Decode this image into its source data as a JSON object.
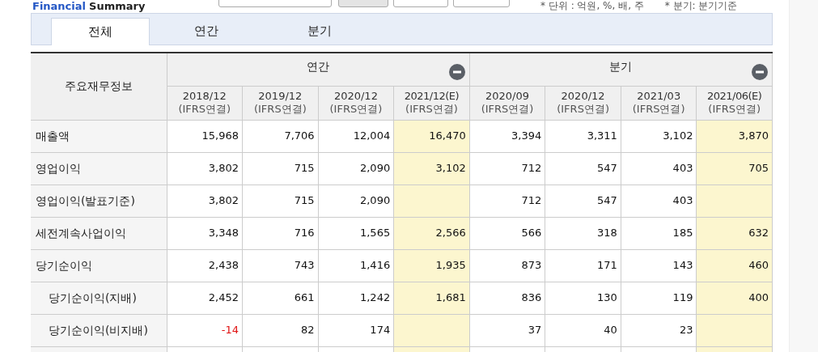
{
  "heading": {
    "part1": "Financial",
    "part2": "Summary"
  },
  "notes": [
    "* 단위 : 억원, %, 배, 주",
    "* 분기: 분기기준"
  ],
  "tabs": [
    {
      "label": "전체",
      "selected": true
    },
    {
      "label": "연간",
      "selected": false
    },
    {
      "label": "분기",
      "selected": false
    }
  ],
  "table": {
    "corner": "주요재무정보",
    "groups": [
      {
        "label": "연간"
      },
      {
        "label": "분기"
      }
    ],
    "columns": [
      {
        "period": "2018/12",
        "basis": "(IFRS연결)",
        "estimate": false
      },
      {
        "period": "2019/12",
        "basis": "(IFRS연결)",
        "estimate": false
      },
      {
        "period": "2020/12",
        "basis": "(IFRS연결)",
        "estimate": false
      },
      {
        "period": "2021/12(E)",
        "basis": "(IFRS연결)",
        "estimate": true
      },
      {
        "period": "2020/09",
        "basis": "(IFRS연결)",
        "estimate": false
      },
      {
        "period": "2020/12",
        "basis": "(IFRS연결)",
        "estimate": false
      },
      {
        "period": "2021/03",
        "basis": "(IFRS연결)",
        "estimate": false
      },
      {
        "period": "2021/06(E)",
        "basis": "(IFRS연결)",
        "estimate": true
      }
    ],
    "rows": [
      {
        "label": "매출액",
        "values": [
          "15,968",
          "7,706",
          "12,004",
          "16,470",
          "3,394",
          "3,311",
          "3,102",
          "3,870"
        ]
      },
      {
        "label": "영업이익",
        "values": [
          "3,802",
          "715",
          "2,090",
          "3,102",
          "712",
          "547",
          "403",
          "705"
        ]
      },
      {
        "label": "영업이익(발표기준)",
        "values": [
          "3,802",
          "715",
          "2,090",
          {
            "kind": "empty"
          },
          "712",
          "547",
          "403",
          {
            "kind": "empty"
          }
        ]
      },
      {
        "label": "세전계속사업이익",
        "values": [
          "3,348",
          "716",
          "1,565",
          "2,566",
          "566",
          "318",
          "185",
          "632"
        ]
      },
      {
        "label": "당기순이익",
        "values": [
          "2,438",
          "743",
          "1,416",
          "1,935",
          "873",
          "171",
          "143",
          "460"
        ],
        "children": [
          {
            "label": "당기순이익(지배)",
            "values": [
              "2,452",
              "661",
              "1,242",
              "1,681",
              "836",
              "130",
              "119",
              "400"
            ]
          },
          {
            "label": "당기순이익(비지배)",
            "values": [
              {
                "text": "-14",
                "negative": true
              },
              "82",
              "174",
              {
                "kind": "empty"
              },
              "37",
              "40",
              "23",
              {
                "kind": "empty"
              }
            ]
          }
        ]
      }
    ]
  }
}
